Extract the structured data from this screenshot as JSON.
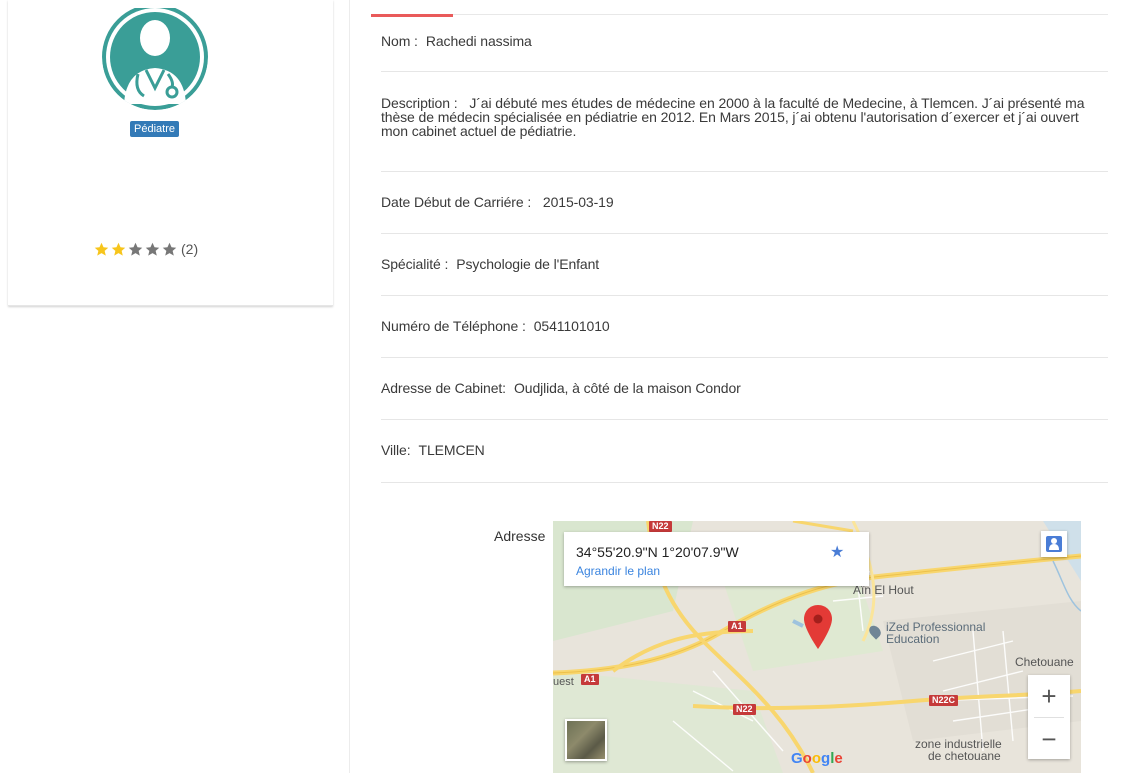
{
  "profile": {
    "role_badge": "Pédiatre",
    "rating": {
      "value": 2,
      "max": 5,
      "count_label": "(2)"
    },
    "colors": {
      "avatar_bg": "#3a9e97",
      "star_filled": "#f7c51c",
      "star_empty": "#777777",
      "badge": "#337ab7"
    }
  },
  "tabs": {
    "accent_color": "#e95a5a"
  },
  "details": {
    "nom": {
      "label": "Nom :",
      "value": "Rachedi nassima"
    },
    "description": {
      "label": "Description :",
      "value": "J´ai débuté mes études de médecine en 2000 à la faculté de Medecine, à Tlemcen. J´ai présenté ma thèse de médecin spécialisée en pédiatrie en 2012. En Mars 2015, j´ai obtenu l'autorisation d´exercer et j´ai ouvert mon cabinet actuel de pédiatrie."
    },
    "date_debut": {
      "label": "Date Début de Carriére :",
      "value": "2015-03-19"
    },
    "specialite": {
      "label": "Spécialité :",
      "value": "Psychologie de l'Enfant"
    },
    "telephone": {
      "label": "Numéro de Téléphone :",
      "value": "0541101010"
    },
    "adresse_cabinet": {
      "label": "Adresse de Cabinet:",
      "value": "Oudjlida, à côté de la maison Condor"
    },
    "ville": {
      "label": "Ville:",
      "value": "TLEMCEN"
    },
    "map_label": "Adresse"
  },
  "map": {
    "coordinates": "34°55'20.9\"N 1°20'07.9\"W",
    "enlarge_link": "Agrandir le plan",
    "places": {
      "ain_el_hout": "Aïn El Hout",
      "ized": "iZed Professionnal",
      "ized_line2": "Education",
      "chetouane": "Chetouane",
      "zone": "zone industrielle",
      "zone_line2": "de chetouane",
      "ouest": "uest"
    },
    "roads": {
      "n22_top": "N22",
      "a1_mid": "A1",
      "a1_left": "A1",
      "n22_bottom": "N22",
      "n22c": "N22C"
    },
    "zoom_in": "+",
    "zoom_out": "−",
    "google": "Google"
  }
}
